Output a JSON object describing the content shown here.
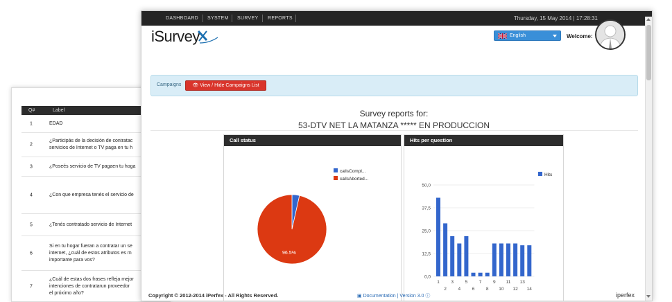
{
  "bg_table": {
    "headers": {
      "q": "Q#",
      "label": "Label"
    },
    "rows": [
      {
        "num": "1",
        "text": "EDAD"
      },
      {
        "num": "2",
        "text": "¿Participás de la decisión de contratac\nservicios de Internet o TV paga en tu h"
      },
      {
        "num": "3",
        "text": "¿Poseés servicio de TV pagaen tu hoga"
      },
      {
        "num": "4",
        "text": "¿Con que empresa tenés el servicio de"
      },
      {
        "num": "5",
        "text": "¿Tenés contratado servicio de Internet"
      },
      {
        "num": "6",
        "text": "Si en tu hogar fueran a contratar un se\ninternet, ¿cuál de estos atributos es m\nimportante para vos?"
      },
      {
        "num": "7",
        "text": "¿Cuál de estas dos frases refleja mejor\nintenciones de contratarun proveedor\nel próximo año?"
      }
    ]
  },
  "nav": {
    "items": [
      "DASHBOARD",
      "SYSTEM",
      "SURVEY",
      "REPORTS"
    ],
    "datetime": "Thursday, 15 May 2014 | 17:28:31"
  },
  "header": {
    "logo_text": "iSurvey",
    "language": "English",
    "welcome": "Welcome:"
  },
  "campaign": {
    "label": "Campaigns",
    "button": "View / Hide Campaigns List"
  },
  "report": {
    "title": "Survey reports for:",
    "subtitle": "53-DTV NET LA MATANZA ***** EN PRODUCCION"
  },
  "panels": {
    "status_title": "Call status",
    "hits_title": "Hits per question"
  },
  "chart_data": [
    {
      "type": "pie",
      "title": "Call status",
      "labels": [
        "callsCompl...",
        "callsAborted..."
      ],
      "values": [
        3.5,
        96.5
      ],
      "colors": [
        "#3366cc",
        "#dc3912"
      ],
      "slice_label": "96.5%",
      "legend_position": "right"
    },
    {
      "type": "bar",
      "title": "Hits per question",
      "categories": [
        "1",
        "2",
        "3",
        "4",
        "5",
        "6",
        "7",
        "8",
        "9",
        "10",
        "11",
        "12",
        "13",
        "14"
      ],
      "x_tick_labels_top": [
        "1",
        "3",
        "5",
        "7",
        "9",
        "11",
        "13"
      ],
      "x_tick_labels_bottom": [
        "2",
        "4",
        "6",
        "8",
        "10",
        "12",
        "14"
      ],
      "series": [
        {
          "name": "Hits",
          "values": [
            43,
            29,
            22,
            18,
            22,
            2,
            2,
            2,
            18,
            18,
            18,
            18,
            17,
            17
          ],
          "color": "#3366cc"
        }
      ],
      "y_ticks": [
        "50,0",
        "37,5",
        "25,0",
        "12,5",
        "0,0"
      ],
      "ylim": [
        0,
        50
      ],
      "legend_position": "top-right"
    }
  ],
  "footer": {
    "copyright": "Copyright © 2012-2014 iPerfex - All Rights Reserved.",
    "docs": "Documentation | Version 3.0",
    "brand": "iperfex"
  }
}
